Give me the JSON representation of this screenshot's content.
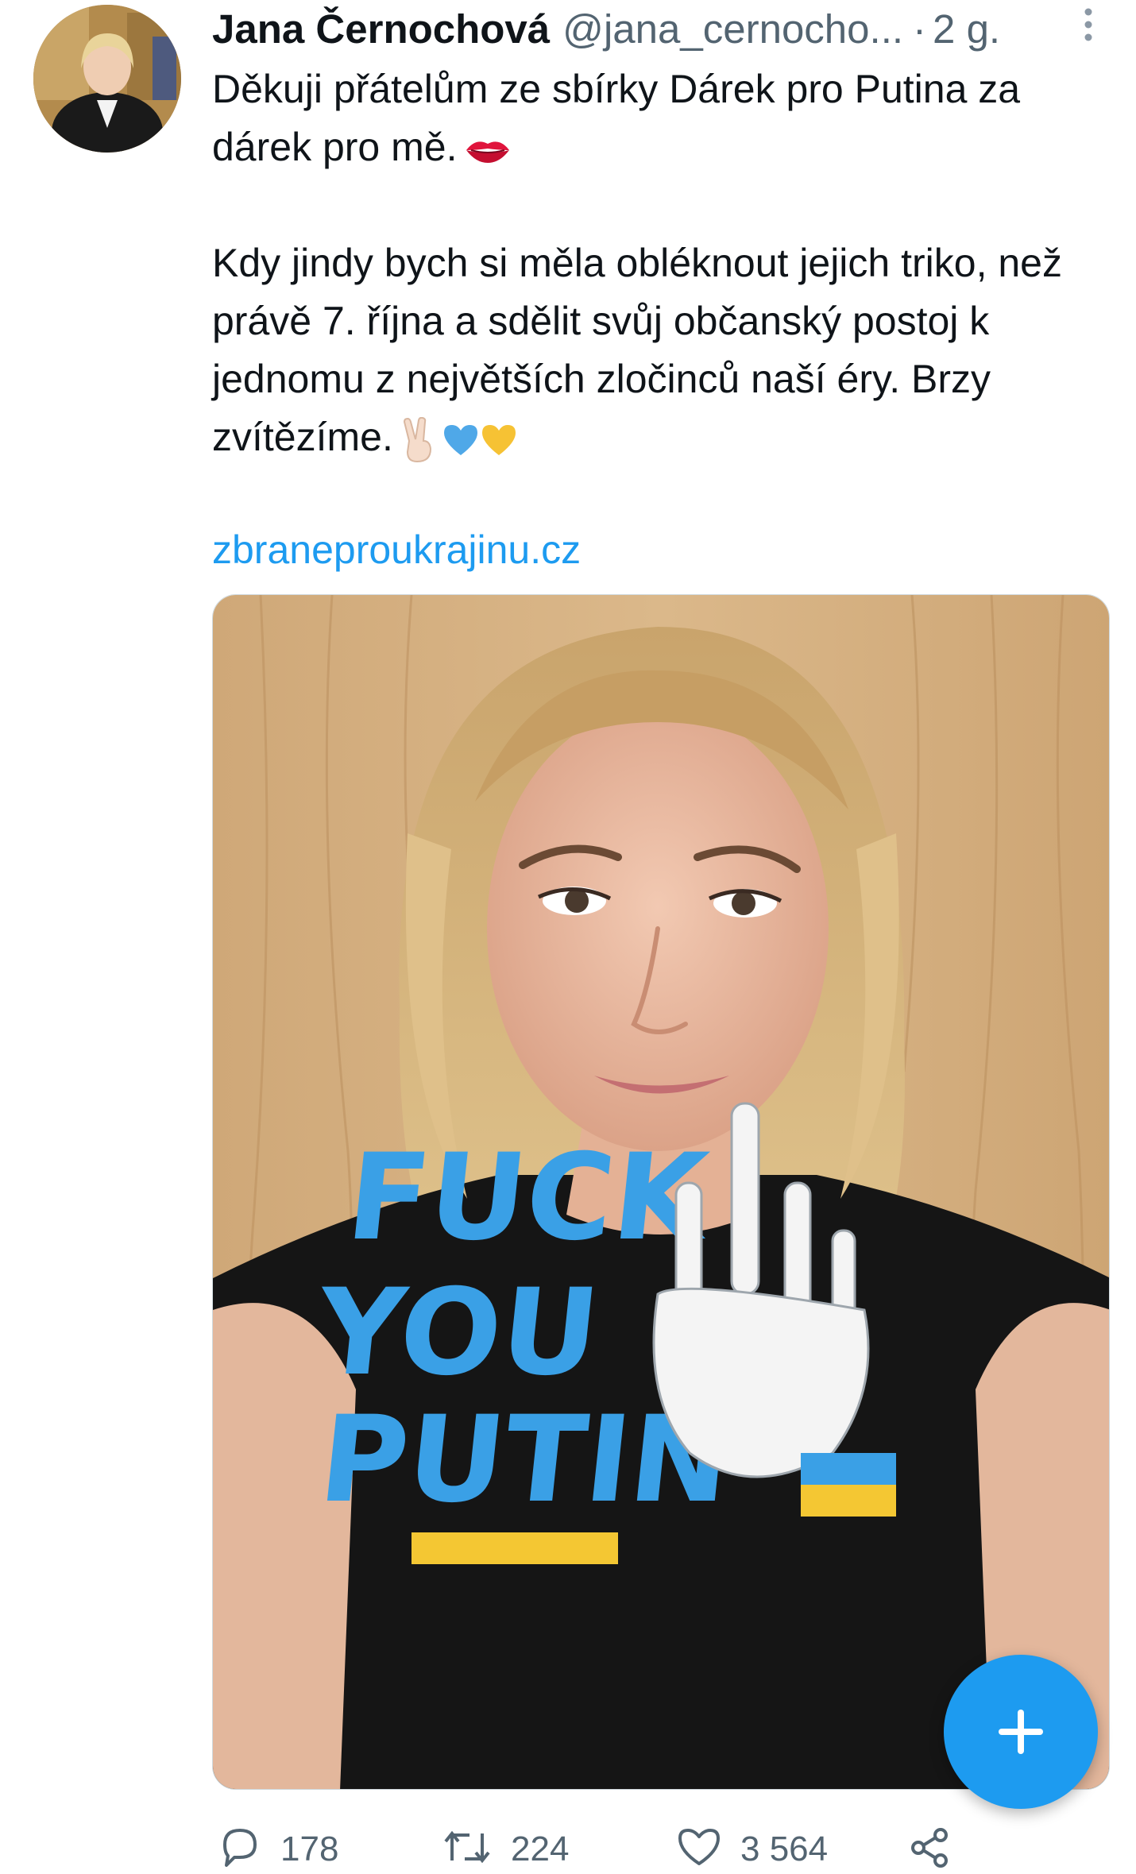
{
  "tweet": {
    "author_name": "Jana Černochová",
    "handle": "@jana_cernocho...",
    "separator": "·",
    "time": "2 g.",
    "text_line_1": "Děkuji přátelům ze sbírky Dárek pro Putina za dárek pro mě.",
    "text_line_2": "Kdy jindy bych si měla obléknout jejich triko, než právě 7. října a sdělit svůj občanský postoj k jednomu z největších zločinců naší éry. Brzy zvítězíme.",
    "link": "zbraneproukrajinu.cz",
    "shirt_print": [
      "FUCK",
      "YOU",
      "PUTIN"
    ]
  },
  "actions": {
    "replies": "178",
    "retweets": "224",
    "likes": "3 564"
  },
  "icons": {
    "more": "more-vertical-icon",
    "reply": "reply-icon",
    "retweet": "retweet-icon",
    "like": "heart-icon",
    "share": "share-icon",
    "compose": "plus-icon"
  },
  "colors": {
    "accent": "#1d9bf0",
    "text": "#0f1419",
    "secondary": "#536471"
  }
}
